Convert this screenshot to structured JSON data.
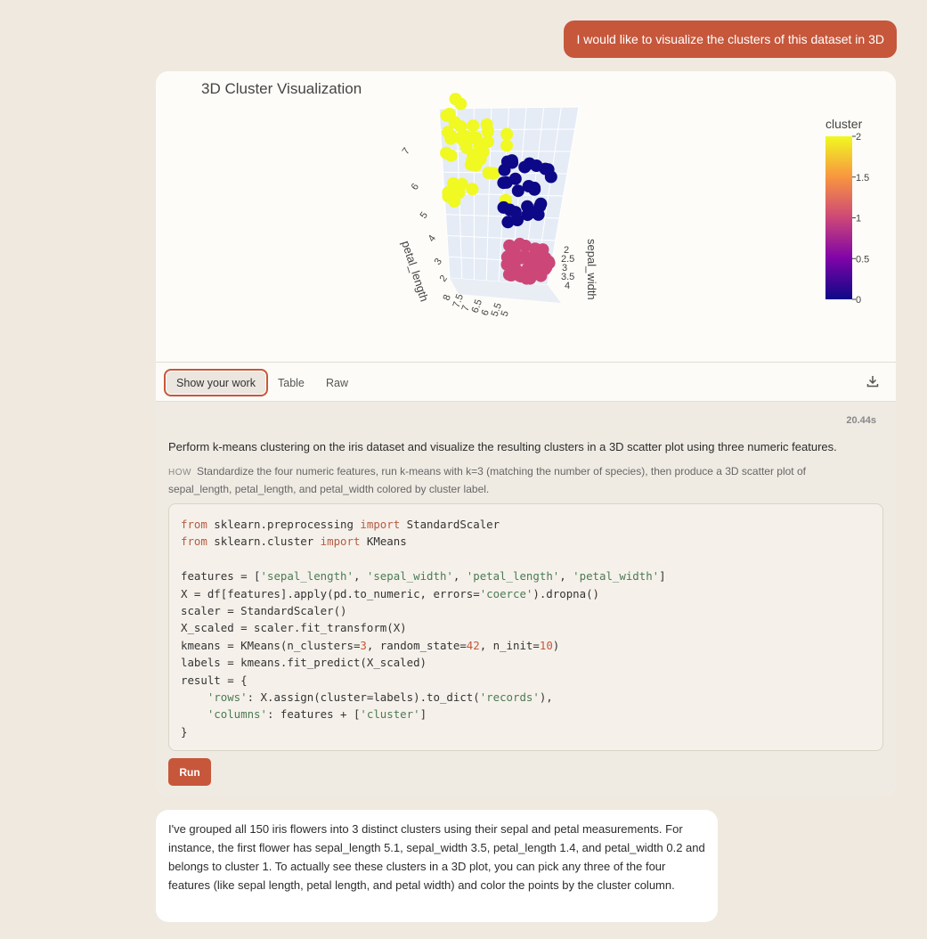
{
  "user_message": "I would like to visualize the clusters of this dataset in 3D",
  "chart": {
    "title": "3D Cluster Visualization",
    "colorbar_title": "cluster",
    "colorbar_ticks": [
      "2",
      "1.5",
      "1",
      "0.5",
      "0"
    ],
    "axis_label_left": "petal_length",
    "axis_label_right": "sepal_width",
    "left_ticks": [
      "7",
      "6",
      "5",
      "4",
      "3",
      "2",
      "8",
      "7.5",
      "7",
      "6.5",
      "6",
      "5.5",
      "5"
    ],
    "right_ticks": [
      "2",
      "2.5",
      "3",
      "3.5",
      "4"
    ],
    "colors": {
      "cluster_0": "#0d0887",
      "cluster_1": "#cc4778",
      "cluster_2": "#f0f921"
    }
  },
  "chart_data": {
    "type": "scatter",
    "title": "3D Cluster Visualization",
    "colorbar": {
      "title": "cluster",
      "range": [
        0,
        2
      ],
      "ticks": [
        0,
        0.5,
        1,
        1.5,
        2
      ],
      "colorscale": "plasma"
    },
    "axes": {
      "x": "sepal_width",
      "y": "petal_length"
    },
    "series": [
      {
        "name": "0",
        "color": "#0d0887"
      },
      {
        "name": "1",
        "color": "#cc4778"
      },
      {
        "name": "2",
        "color": "#f0f921"
      }
    ]
  },
  "tabs": [
    {
      "label": "Show your work",
      "active": true
    },
    {
      "label": "Table",
      "active": false
    },
    {
      "label": "Raw",
      "active": false
    }
  ],
  "work": {
    "duration": "20.44s",
    "summary": "Perform k-means clustering on the iris dataset and visualize the resulting clusters in a 3D scatter plot using three numeric features.",
    "how_label": "HOW",
    "how_text": "Standardize the four numeric features, run k-means with k=3 (matching the number of species), then produce a 3D scatter plot of sepal_length, petal_length, and petal_width colored by cluster label.",
    "code_lines": [
      "from sklearn.preprocessing import StandardScaler",
      "from sklearn.cluster import KMeans",
      "",
      "features = ['sepal_length', 'sepal_width', 'petal_length', 'petal_width']",
      "X = df[features].apply(pd.to_numeric, errors='coerce').dropna()",
      "scaler = StandardScaler()",
      "X_scaled = scaler.fit_transform(X)",
      "kmeans = KMeans(n_clusters=3, random_state=42, n_init=10)",
      "labels = kmeans.fit_predict(X_scaled)",
      "result = {",
      "    'rows': X.assign(cluster=labels).to_dict('records'),",
      "    'columns': features + ['cluster']",
      "}"
    ],
    "run_label": "Run"
  },
  "reply": "I've grouped all 150 iris flowers into 3 distinct clusters using their sepal and petal measurements. For instance, the first flower has sepal_length 5.1, sepal_width 3.5, petal_length 1.4, and petal_width 0.2 and belongs to cluster 1. To actually see these clusters in a 3D plot, you can pick any three of the four features (like sepal length, petal length, and petal width) and color the points by the cluster column."
}
